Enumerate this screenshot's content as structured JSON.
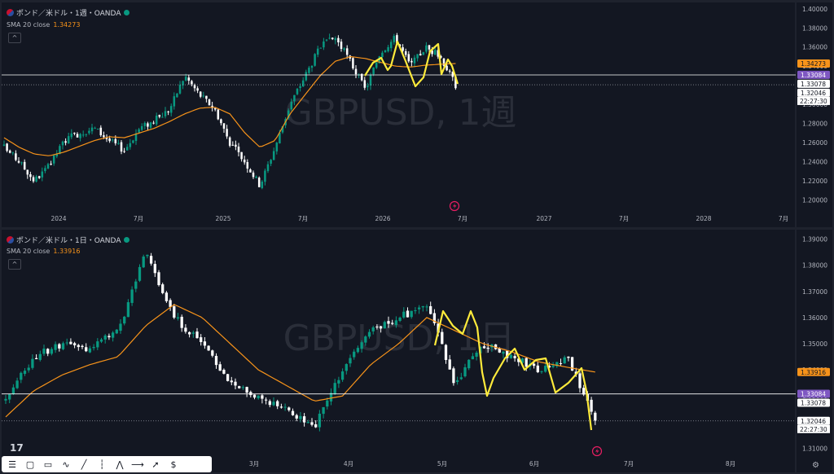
{
  "charts": [
    {
      "symbol_title": "ポンド／米ドル・1週・OANDA",
      "watermark": "GBPUSD, 1週",
      "sma_label": "SMA 20 close",
      "sma_value": "1.34273",
      "price_min": 1.19,
      "price_max": 1.405,
      "price_ticks": [
        "1.40000",
        "1.38000",
        "1.36000",
        "1.34000",
        "1.32000",
        "1.30000",
        "1.28000",
        "1.26000",
        "1.24000",
        "1.22000",
        "1.20000"
      ],
      "time_labels": [
        "2024",
        "7月",
        "2025",
        "7月",
        "2026",
        "7月",
        "2027",
        "7月",
        "2028",
        "7月"
      ],
      "badges": [
        {
          "text": "1.34273",
          "value": 1.34273,
          "color": "#f7931a",
          "text_color": "#131722"
        },
        {
          "text": "1.33084",
          "value": 1.33084,
          "color": "#7e57c2",
          "text_color": "#ffffff"
        },
        {
          "text": "1.33078",
          "value": 1.33078,
          "color": "#ffffff",
          "text_color": "#131722"
        },
        {
          "text": "1.32046",
          "value": 1.32046,
          "color": "#ffffff",
          "text_color": "#131722"
        }
      ],
      "countdown": "22:27:30",
      "hline": 1.33078,
      "dotted_line": 1.32046
    },
    {
      "symbol_title": "ポンド／米ドル・1日・OANDA",
      "watermark": "GBPUSD, 1日",
      "sma_label": "SMA 20 close",
      "sma_value": "1.33916",
      "price_min": 1.307,
      "price_max": 1.393,
      "price_ticks": [
        "1.39000",
        "1.38000",
        "1.37000",
        "1.36000",
        "1.35000",
        "1.34000",
        "1.33000",
        "1.32000",
        "1.31000"
      ],
      "time_labels": [
        "3月",
        "4月",
        "5月",
        "6月",
        "7月",
        "8月"
      ],
      "badges": [
        {
          "text": "1.33916",
          "value": 1.33916,
          "color": "#f7931a",
          "text_color": "#131722"
        },
        {
          "text": "1.33084",
          "value": 1.33084,
          "color": "#7e57c2",
          "text_color": "#ffffff"
        },
        {
          "text": "1.33078",
          "value": 1.33078,
          "color": "#ffffff",
          "text_color": "#131722"
        },
        {
          "text": "1.32046",
          "value": 1.32046,
          "color": "#ffffff",
          "text_color": "#131722"
        }
      ],
      "countdown": "22:27:30",
      "hline": 1.33078,
      "dotted_line": 1.32046
    }
  ],
  "chart_data": [
    {
      "type": "candlestick",
      "title": "ポンド／米ドル・1週・OANDA",
      "series": [
        {
          "name": "SMA 20 close",
          "values": [
            1.265,
            1.255,
            1.248,
            1.246,
            1.25,
            1.256,
            1.262,
            1.266,
            1.265,
            1.27,
            1.275,
            1.282,
            1.29,
            1.296,
            1.297,
            1.29,
            1.27,
            1.255,
            1.262,
            1.29,
            1.31,
            1.33,
            1.345,
            1.35,
            1.348,
            1.344,
            1.34,
            1.339,
            1.341,
            1.342,
            1.34273
          ]
        },
        {
          "name": "close",
          "values": [
            1.255,
            1.24,
            1.22,
            1.235,
            1.262,
            1.27,
            1.275,
            1.262,
            1.252,
            1.275,
            1.283,
            1.295,
            1.33,
            1.31,
            1.295,
            1.26,
            1.24,
            1.215,
            1.255,
            1.3,
            1.33,
            1.36,
            1.37,
            1.345,
            1.315,
            1.355,
            1.37,
            1.34,
            1.36,
            1.35,
            1.32046
          ]
        }
      ],
      "x_range": [
        "2023-10",
        "2028-10"
      ],
      "ylim": [
        1.19,
        1.405
      ]
    },
    {
      "type": "candlestick",
      "title": "ポンド／米ドル・1日・OANDA",
      "series": [
        {
          "name": "SMA 20 close",
          "values": [
            1.322,
            1.332,
            1.338,
            1.342,
            1.345,
            1.357,
            1.365,
            1.36,
            1.35,
            1.34,
            1.334,
            1.328,
            1.33,
            1.342,
            1.35,
            1.36,
            1.355,
            1.35,
            1.347,
            1.343,
            1.341,
            1.33916
          ]
        },
        {
          "name": "close",
          "values": [
            1.33,
            1.345,
            1.35,
            1.348,
            1.355,
            1.385,
            1.36,
            1.35,
            1.335,
            1.33,
            1.325,
            1.318,
            1.34,
            1.355,
            1.36,
            1.365,
            1.335,
            1.35,
            1.345,
            1.34,
            1.345,
            1.32046
          ]
        }
      ],
      "x_range": [
        "2026-01-20",
        "2026-08-25"
      ],
      "ylim": [
        1.307,
        1.393
      ]
    }
  ]
}
